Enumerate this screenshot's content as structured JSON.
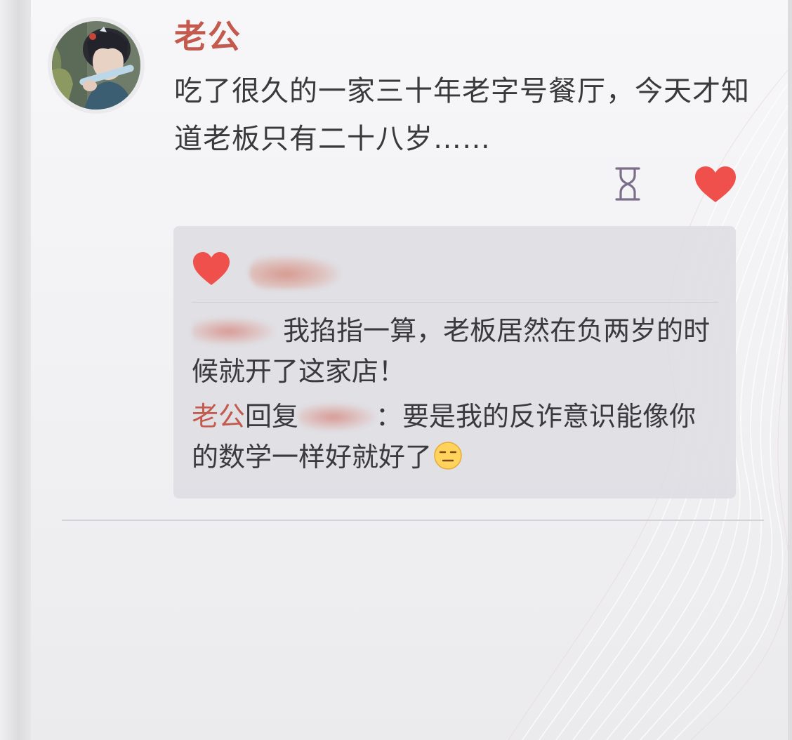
{
  "post": {
    "author": "老公",
    "text": "吃了很久的一家三十年老字号餐厅，今天才知道老板只有二十八岁……",
    "actions": {
      "history_icon": "hourglass-icon",
      "like_icon": "heart-icon",
      "like_color": "#f0504c"
    }
  },
  "comments": [
    {
      "author": "",
      "text": "我掐指一算，老板居然在负两岁的时候就开了这家店！"
    },
    {
      "author": "老公",
      "reply_label": "回复",
      "reply_to": "",
      "separator": "：",
      "text": "要是我的反诈意识能像你的数学一样好就好了",
      "emoji": "expressionless-face-emoji"
    }
  ],
  "colors": {
    "author_name": "#c35a4d",
    "body_text": "#3a3a3d",
    "comment_bg": "#dedde2"
  }
}
